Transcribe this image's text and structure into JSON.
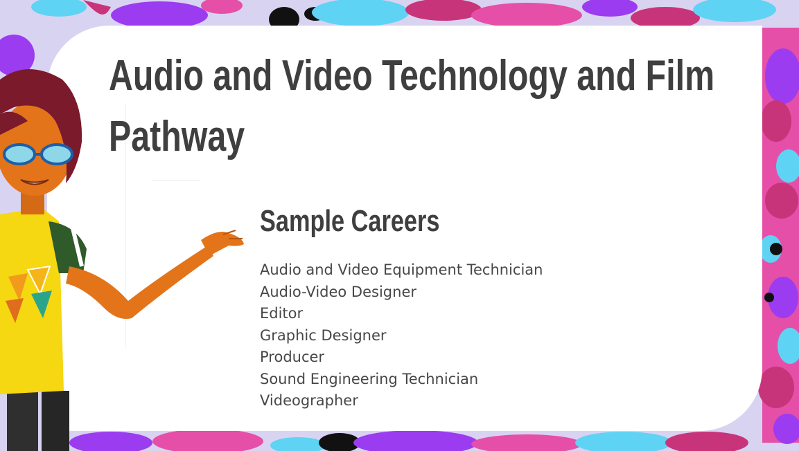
{
  "slide": {
    "title": "Audio and Video Technology and Film Pathway",
    "subtitle": "Sample Careers",
    "careers": [
      "Audio and Video Equipment Technician",
      "Audio-Video Designer",
      "Editor",
      "Graphic Designer",
      "Producer",
      "Sound Engineering Technician",
      "Videographer"
    ]
  },
  "colors": {
    "background": "#d9d3f2",
    "card": "#ffffff",
    "title_text": "#3f3f3f",
    "body_text": "#474747",
    "splash_purple": "#9b3cf0",
    "splash_cyan": "#5fd3f3",
    "splash_pink": "#e64fa8",
    "splash_magenta": "#c8347a",
    "splash_black": "#111111"
  },
  "illustration": {
    "icon": "presenter-character-illustration"
  }
}
